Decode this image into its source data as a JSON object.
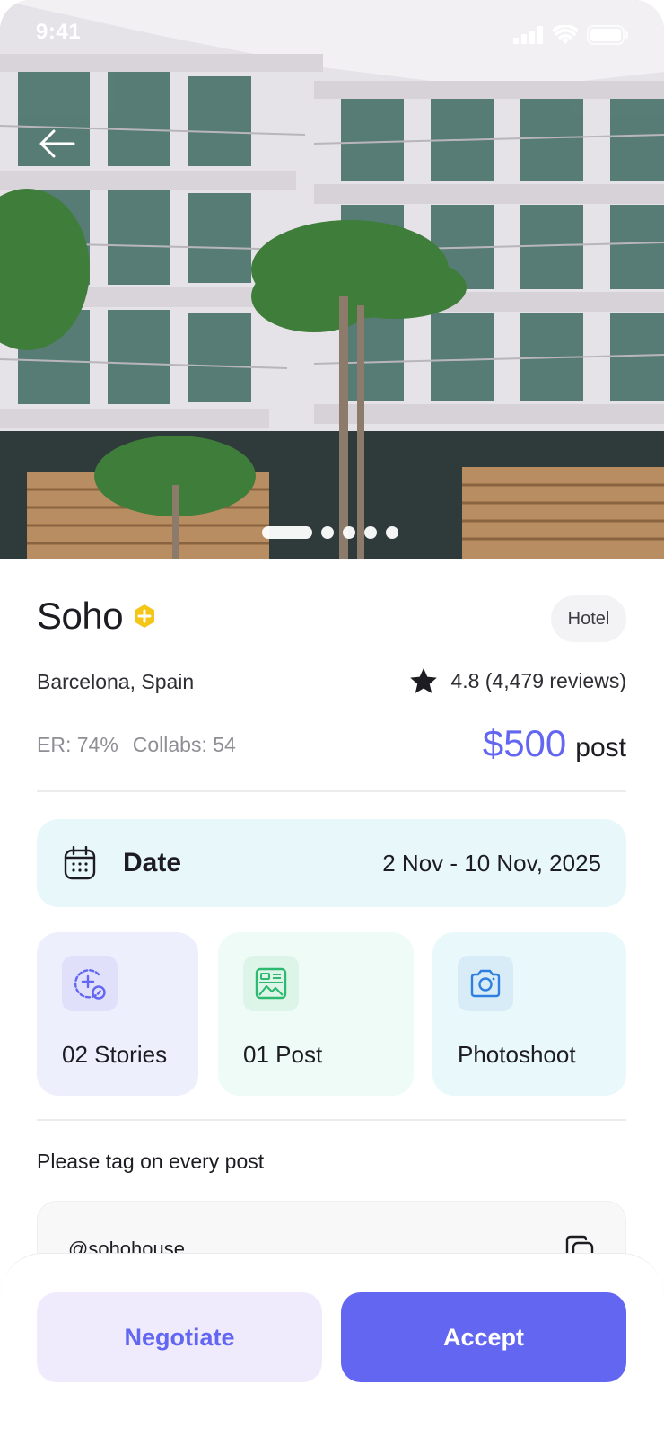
{
  "status_bar": {
    "time": "9:41"
  },
  "hero": {
    "image_alt": "hotel photo",
    "carousel": {
      "count": 5,
      "active_index": 0
    }
  },
  "listing": {
    "name": "Soho",
    "type": "Hotel",
    "location": "Barcelona, Spain",
    "rating": "4.8 (4,479 reviews)",
    "er": "ER: 74%",
    "collabs": "Collabs: 54",
    "price": "$500",
    "price_unit": "post"
  },
  "date": {
    "label": "Date",
    "value": "2 Nov - 10 Nov, 2025"
  },
  "deliverables": [
    {
      "label": "02 Stories",
      "icon": "story-add-icon"
    },
    {
      "label": "01 Post",
      "icon": "post-image-icon"
    },
    {
      "label": "Photoshoot",
      "icon": "camera-icon"
    }
  ],
  "tag": {
    "note": "Please tag on every post",
    "handle": "@sohohouse"
  },
  "actions": {
    "negotiate": "Negotiate",
    "accept": "Accept"
  },
  "colors": {
    "accent": "#6366f1",
    "accent_light": "#efebfd",
    "date_bg": "#e8f8fa",
    "verified": "#f5c518"
  }
}
